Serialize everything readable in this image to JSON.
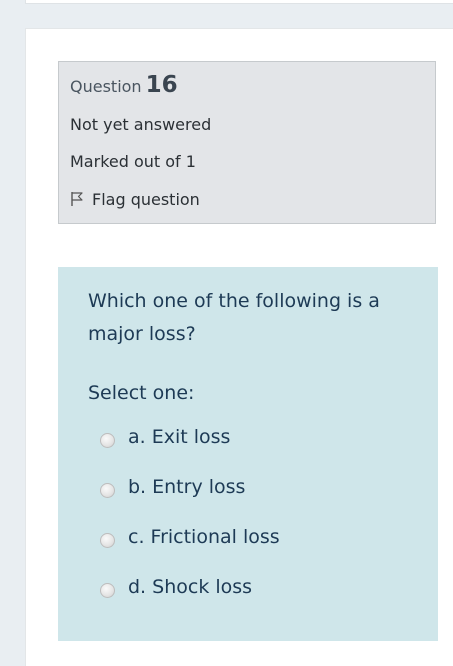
{
  "question_info": {
    "label": "Question",
    "number": "16",
    "state": "Not yet answered",
    "grade": "Marked out of 1",
    "flag_label": "Flag question"
  },
  "question": {
    "text": "Which one of the following is a major loss?",
    "prompt": "Select one:",
    "options": [
      {
        "label": "a. Exit loss",
        "selected": false
      },
      {
        "label": "b. Entry loss",
        "selected": false
      },
      {
        "label": "c. Frictional loss",
        "selected": false
      },
      {
        "label": "d. Shock loss",
        "selected": false
      }
    ]
  },
  "colors": {
    "info_bg": "#e3e5e8",
    "content_bg": "#cfe6ea",
    "question_text": "#1d3a55"
  },
  "icons": {
    "flag": "flag-icon",
    "radio": "radio-icon"
  }
}
